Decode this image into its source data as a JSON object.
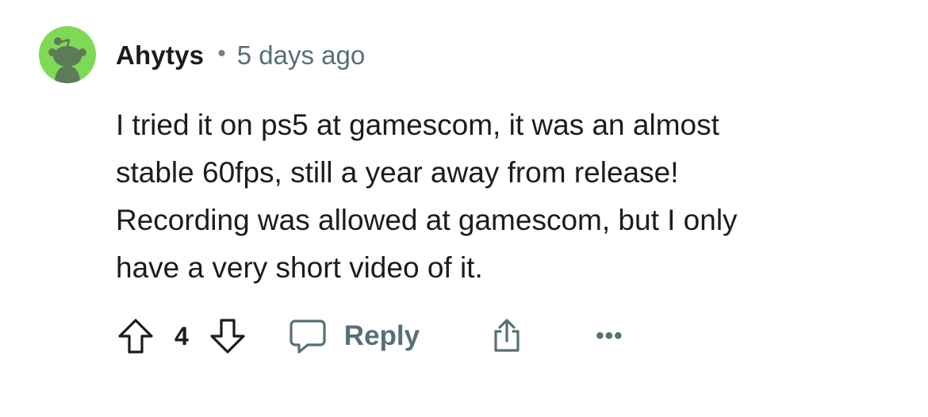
{
  "comment": {
    "author": "Ahytys",
    "separator": "•",
    "timestamp": "5 days ago",
    "body_lines": [
      "I tried it on ps5 at gamescom, it was an almost",
      "stable 60fps, still a year away from release!",
      "Recording was allowed at gamescom, but I only",
      "have a very short video of it."
    ],
    "vote_count": "4",
    "reply_label": "Reply",
    "more_label": "•••"
  },
  "icons": {
    "avatar": "reddit-snoo-avatar-icon",
    "upvote": "upvote-arrow-icon",
    "downvote": "downvote-arrow-icon",
    "reply": "speech-bubble-icon",
    "share": "share-icon",
    "more": "more-options-icon"
  },
  "colors": {
    "avatar_background": "#7ed957",
    "text_primary": "#1c1c1c",
    "text_secondary": "#576f76"
  }
}
